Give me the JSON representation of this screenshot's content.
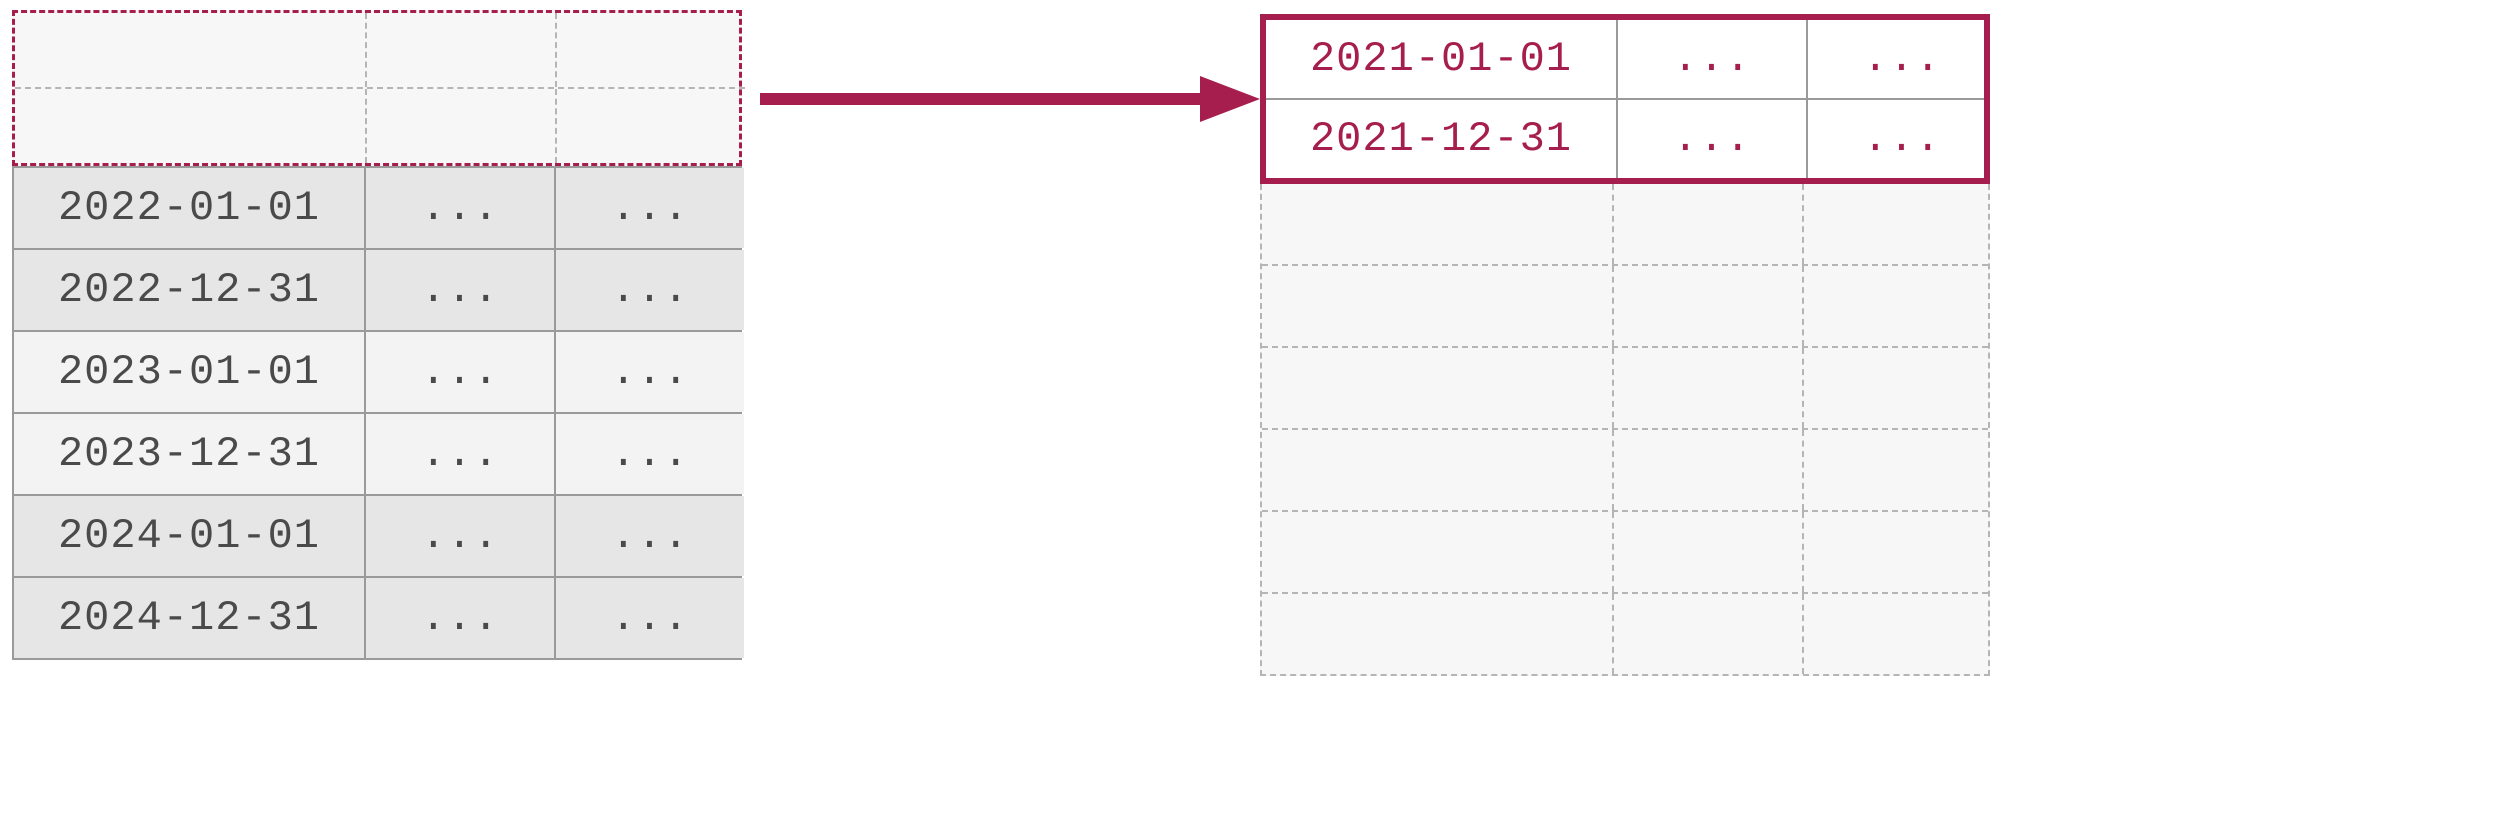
{
  "colors": {
    "accent": "#a61e4d",
    "solid_border": "#9a9a9a",
    "dash_border": "#b5b5b5",
    "ghost_bg": "#f7f7f7",
    "row_alt": "#e6e6e6",
    "row_base": "#f3f3f3",
    "text": "#4a4a4a"
  },
  "ellipsis": "...",
  "left_table": {
    "ghost_rows_count": 2,
    "rows": [
      {
        "date": "2022-01-01",
        "col2": "...",
        "col3": "...",
        "shaded": true
      },
      {
        "date": "2022-12-31",
        "col2": "...",
        "col3": "...",
        "shaded": true
      },
      {
        "date": "2023-01-01",
        "col2": "...",
        "col3": "...",
        "shaded": false
      },
      {
        "date": "2023-12-31",
        "col2": "...",
        "col3": "...",
        "shaded": false
      },
      {
        "date": "2024-01-01",
        "col2": "...",
        "col3": "...",
        "shaded": true
      },
      {
        "date": "2024-12-31",
        "col2": "...",
        "col3": "...",
        "shaded": true
      }
    ]
  },
  "right_table": {
    "highlighted_rows": [
      {
        "date": "2021-01-01",
        "col2": "...",
        "col3": "..."
      },
      {
        "date": "2021-12-31",
        "col2": "...",
        "col3": "..."
      }
    ],
    "ghost_rows_count": 6
  }
}
